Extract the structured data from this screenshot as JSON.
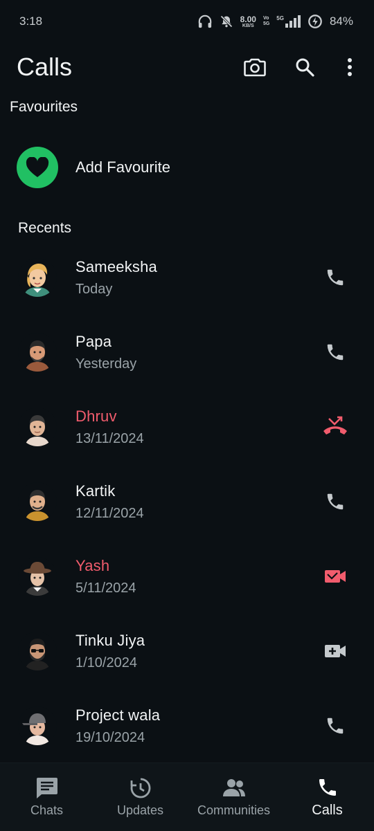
{
  "status": {
    "time": "3:18",
    "speed_value": "8.00",
    "speed_unit": "KB/S",
    "volte_top": "Vo",
    "volte_bottom": "5G",
    "network": "5G",
    "battery": "84%"
  },
  "header": {
    "title": "Calls"
  },
  "favourites": {
    "section_label": "Favourites",
    "add_label": "Add Favourite",
    "accent": "#21c063"
  },
  "recents": {
    "section_label": "Recents",
    "items": [
      {
        "name": "Sameeksha",
        "date": "Today",
        "missed": false,
        "call_icon": "phone-icon"
      },
      {
        "name": "Papa",
        "date": "Yesterday",
        "missed": false,
        "call_icon": "phone-icon"
      },
      {
        "name": "Dhruv",
        "date": "13/11/2024",
        "missed": true,
        "call_icon": "missed-call-icon"
      },
      {
        "name": "Kartik",
        "date": "12/11/2024",
        "missed": false,
        "call_icon": "phone-icon"
      },
      {
        "name": "Yash",
        "date": "5/11/2024",
        "missed": true,
        "call_icon": "missed-video-call-icon"
      },
      {
        "name": "Tinku Jiya",
        "date": "1/10/2024",
        "missed": false,
        "call_icon": "video-call-icon"
      },
      {
        "name": "Project wala",
        "date": "19/10/2024",
        "missed": false,
        "call_icon": "phone-icon"
      }
    ],
    "missed_color": "#f15c6d"
  },
  "nav": {
    "items": [
      {
        "label": "Chats",
        "icon": "chat-icon",
        "active": false
      },
      {
        "label": "Updates",
        "icon": "updates-icon",
        "active": false
      },
      {
        "label": "Communities",
        "icon": "communities-icon",
        "active": false
      },
      {
        "label": "Calls",
        "icon": "phone-icon",
        "active": true
      }
    ]
  }
}
